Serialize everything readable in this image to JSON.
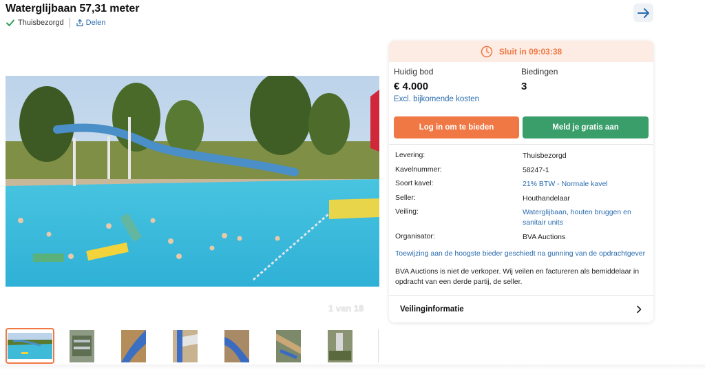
{
  "header": {
    "title": "Waterglijbaan 57,31 meter",
    "delivery_badge": "Thuisbezorgd",
    "share_label": "Delen"
  },
  "gallery": {
    "counter": "1 van 18",
    "thumbnail_count": 7,
    "active_index": 0
  },
  "card": {
    "timer": "Sluit in 09:03:38",
    "current_bid_label": "Huidig bod",
    "current_bid_value": "€ 4.000",
    "bids_label": "Biedingen",
    "bids_value": "3",
    "excl_costs": "Excl. bijkomende kosten",
    "login_button": "Log in om te bieden",
    "register_button": "Meld je gratis aan",
    "details": [
      {
        "key": "Levering:",
        "value": "Thuisbezorgd",
        "link": false
      },
      {
        "key": "Kavelnummer:",
        "value": "58247-1",
        "link": false
      },
      {
        "key": "Soort kavel:",
        "value": "21% BTW - Normale kavel",
        "link": true
      },
      {
        "key": "Seller:",
        "value": "Houthandelaar",
        "link": false
      },
      {
        "key": "Veiling:",
        "value": "Waterglijbaan, houten bruggen en sanitair units",
        "link": true
      },
      {
        "key": "Organisator:",
        "value": "BVA Auctions",
        "link": false
      }
    ],
    "notice": "Toewijzing aan de hoogste bieder geschiedt na gunning van de opdrachtgever",
    "disclaimer": "BVA Auctions is niet de verkoper. Wij veilen en factureren als bemiddelaar in opdracht van een derde partij, de seller.",
    "auction_info": "Veilinginformatie"
  },
  "colors": {
    "accent_orange": "#f07845",
    "accent_green": "#3a9e6b",
    "link_blue": "#2b6cb0",
    "timer_bg": "#fdece3"
  }
}
